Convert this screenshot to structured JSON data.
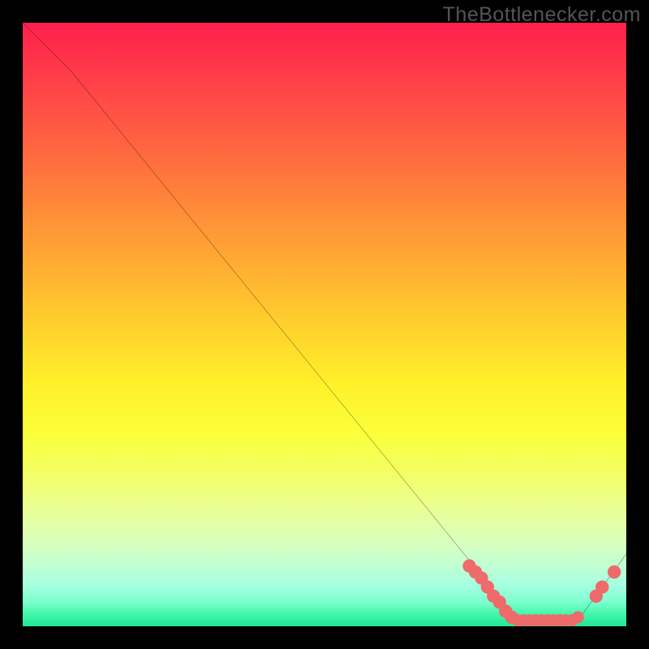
{
  "watermark": "TheBottlenecker.com",
  "chart_data": {
    "type": "line",
    "title": "",
    "xlabel": "",
    "ylabel": "",
    "xlim": [
      0,
      100
    ],
    "ylim": [
      0,
      100
    ],
    "series": [
      {
        "name": "curve",
        "x": [
          0,
          8,
          78,
          82,
          92,
          100
        ],
        "y": [
          100,
          92,
          6,
          1,
          1,
          12
        ]
      }
    ],
    "markers": {
      "name": "salmon-dots",
      "color": "#ef6a6a",
      "points": [
        {
          "x": 74,
          "y": 10,
          "r": 1.1
        },
        {
          "x": 75,
          "y": 9,
          "r": 1.1
        },
        {
          "x": 76,
          "y": 8,
          "r": 1.1
        },
        {
          "x": 77,
          "y": 6.5,
          "r": 1.1
        },
        {
          "x": 78,
          "y": 5,
          "r": 1.1
        },
        {
          "x": 79,
          "y": 4,
          "r": 1.1
        },
        {
          "x": 80,
          "y": 2.5,
          "r": 1.1
        },
        {
          "x": 81,
          "y": 1.5,
          "r": 1.1
        },
        {
          "x": 82,
          "y": 1,
          "r": 1.0
        },
        {
          "x": 83,
          "y": 1,
          "r": 1.0
        },
        {
          "x": 84,
          "y": 1,
          "r": 1.0
        },
        {
          "x": 85,
          "y": 1,
          "r": 1.0
        },
        {
          "x": 86,
          "y": 1,
          "r": 1.0
        },
        {
          "x": 87,
          "y": 1,
          "r": 1.0
        },
        {
          "x": 88,
          "y": 1,
          "r": 1.0
        },
        {
          "x": 89,
          "y": 1,
          "r": 1.0
        },
        {
          "x": 90,
          "y": 1,
          "r": 1.0
        },
        {
          "x": 91,
          "y": 1,
          "r": 1.0
        },
        {
          "x": 92,
          "y": 1.5,
          "r": 1.0
        },
        {
          "x": 95,
          "y": 5,
          "r": 1.1
        },
        {
          "x": 96,
          "y": 6.5,
          "r": 1.1
        },
        {
          "x": 98,
          "y": 9,
          "r": 1.1
        }
      ]
    },
    "gradient_stops": [
      {
        "pos": 0,
        "color": "#ff1f4b"
      },
      {
        "pos": 60,
        "color": "#fff12a"
      },
      {
        "pos": 100,
        "color": "#1fe895"
      }
    ]
  }
}
